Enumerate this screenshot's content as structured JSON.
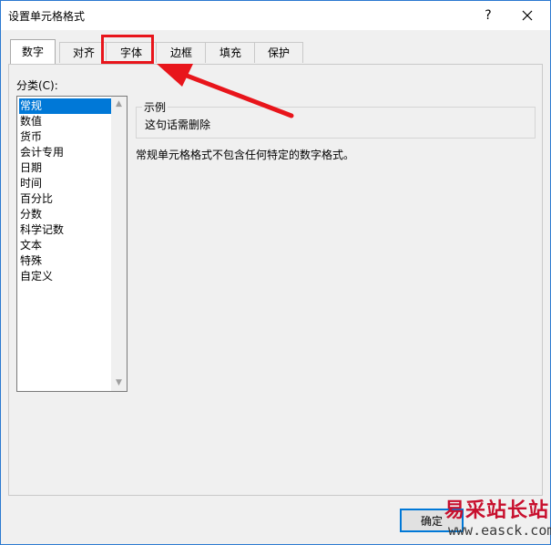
{
  "dialog": {
    "title": "设置单元格格式",
    "help_glyph": "?",
    "close_icon": "close-icon"
  },
  "tabs": [
    {
      "label": "数字",
      "active": true
    },
    {
      "label": "对齐",
      "active": false
    },
    {
      "label": "字体",
      "active": false,
      "highlighted": true
    },
    {
      "label": "边框",
      "active": false
    },
    {
      "label": "填充",
      "active": false
    },
    {
      "label": "保护",
      "active": false
    }
  ],
  "category": {
    "label": "分类(C):",
    "items": [
      "常规",
      "数值",
      "货币",
      "会计专用",
      "日期",
      "时间",
      "百分比",
      "分数",
      "科学记数",
      "文本",
      "特殊",
      "自定义"
    ],
    "selected_index": 0
  },
  "sample": {
    "legend": "示例",
    "value": "这句话需删除"
  },
  "description": "常规单元格格式不包含任何特定的数字格式。",
  "buttons": {
    "ok_label": "确定"
  },
  "annotation": {
    "highlight_color": "#e8151b",
    "arrow_color": "#e8151b"
  },
  "watermark": {
    "cn": "易采站长站",
    "url": "www.easck.com"
  }
}
